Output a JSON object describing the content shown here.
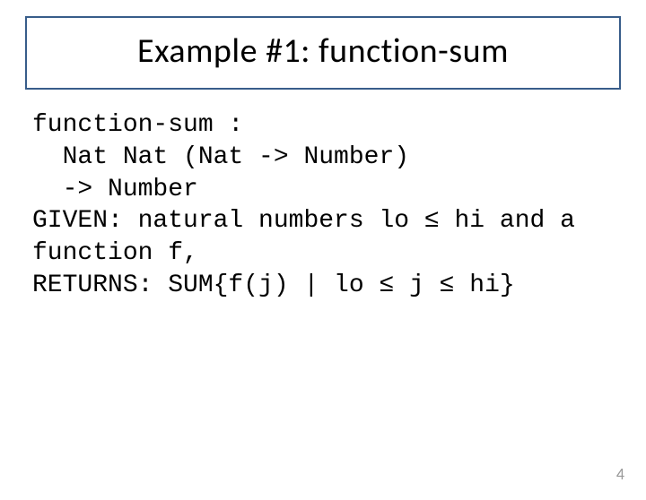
{
  "title": "Example #1: function-sum",
  "code_lines": {
    "l1": "function-sum :",
    "l2": "  Nat Nat (Nat -> Number)",
    "l3": "  -> Number",
    "l4": "GIVEN: natural numbers lo ≤ hi and a",
    "l5": "function f,",
    "l6": "RETURNS: SUM{f(j) | lo ≤ j ≤ hi}"
  },
  "page_number": "4"
}
